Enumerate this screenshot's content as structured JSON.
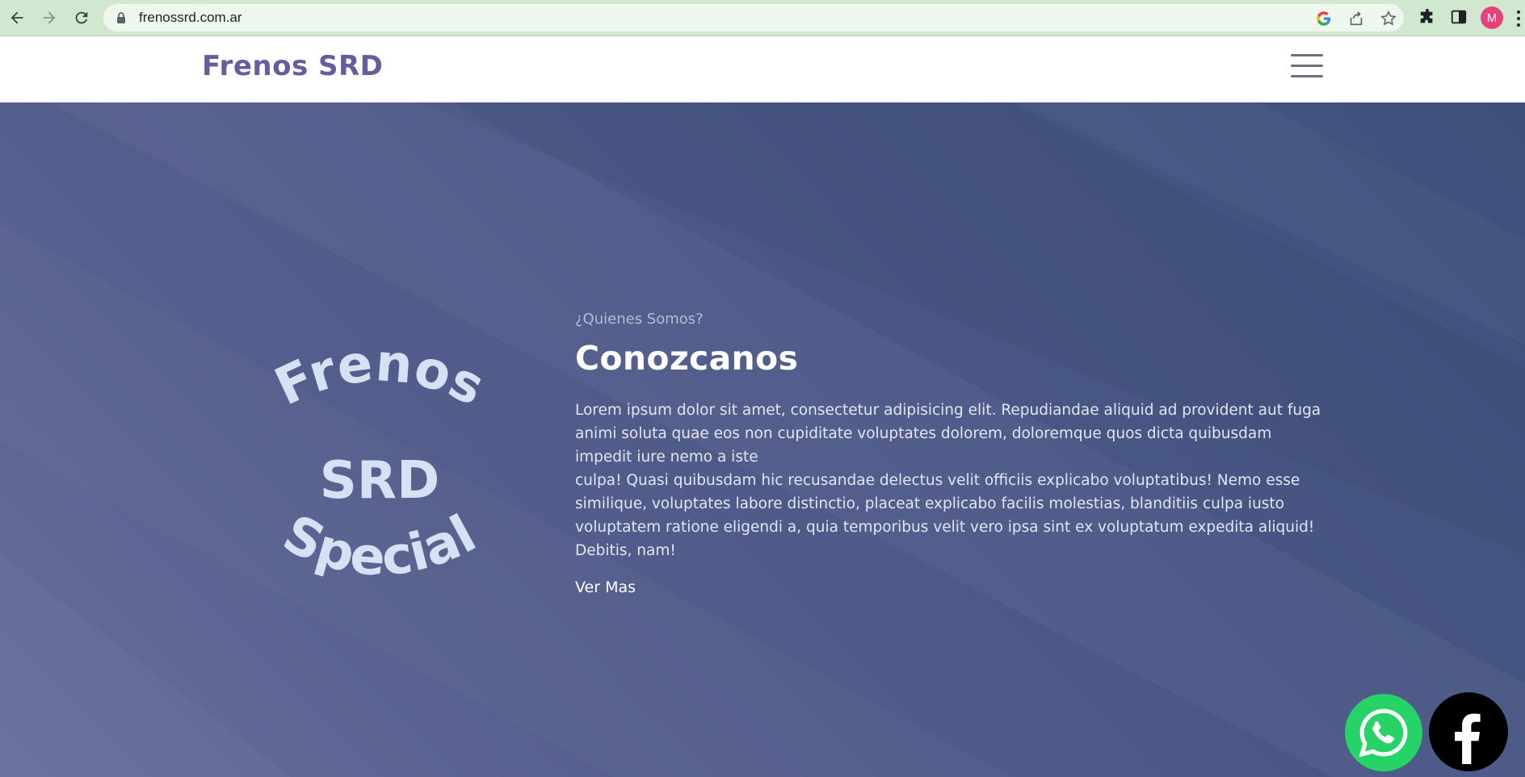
{
  "browser": {
    "url": "frenossrd.com.ar",
    "profile_initial": "M"
  },
  "header": {
    "brand": "Frenos SRD"
  },
  "hero": {
    "logo_lines": [
      "Frenos",
      "SRD",
      "Special"
    ],
    "eyebrow": "¿Quienes Somos?",
    "title": "Conozcanos",
    "paragraph_1": "Lorem ipsum dolor sit amet, consectetur adipisicing elit. Repudiandae aliquid ad provident aut fuga animi soluta quae eos non cupiditate voluptates dolorem, doloremque quos dicta quibusdam impedit iure nemo a iste",
    "paragraph_2": "culpa! Quasi quibusdam hic recusandae delectus velit officiis explicabo voluptatibus! Nemo esse similique, voluptates labore distinctio, placeat explicabo facilis molestias, blanditiis culpa iusto voluptatem ratione eligendi a, quia temporibus velit vero ipsa sint ex voluptatum expedita aliquid! Debitis, nam!",
    "link_label": "Ver Mas"
  },
  "icons": {
    "back": "back-arrow-icon",
    "forward": "forward-arrow-icon",
    "reload": "reload-icon",
    "lock": "lock-icon",
    "google": "google-icon",
    "share": "share-icon",
    "bookmark": "star-icon",
    "extensions": "puzzle-icon",
    "side_panel": "side-panel-icon",
    "menu": "hamburger-menu-icon",
    "whatsapp": "whatsapp-icon",
    "facebook": "facebook-icon"
  },
  "colors": {
    "brand": "#6a5aa0",
    "hero_start": "#676e9c",
    "hero_end": "#3f4f7a",
    "logo_text": "#d6e2f3",
    "whatsapp": "#25d366",
    "facebook": "#000000"
  }
}
